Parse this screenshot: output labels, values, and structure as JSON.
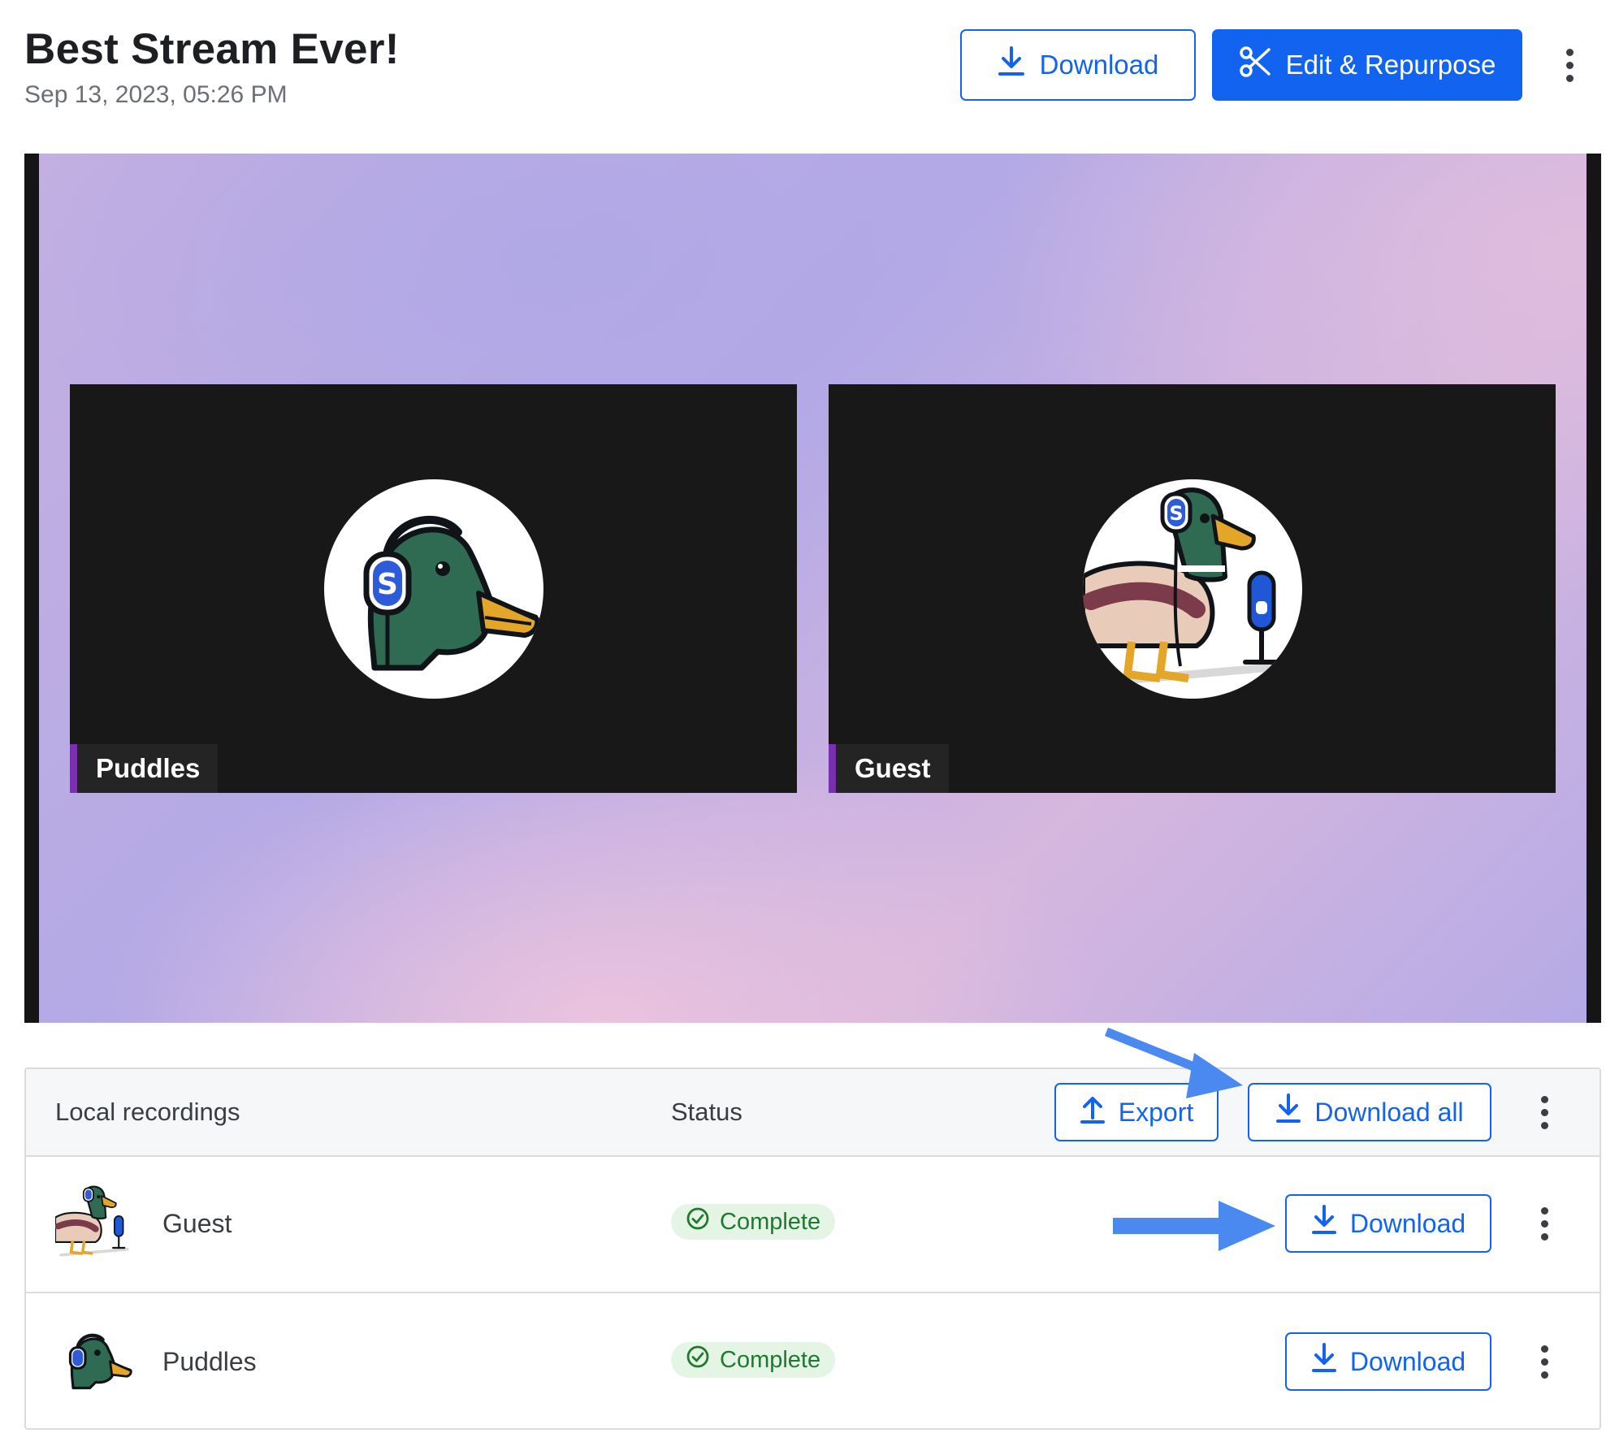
{
  "header": {
    "title": "Best Stream Ever!",
    "date": "Sep 13, 2023, 05:26 PM",
    "download_label": "Download",
    "edit_label": "Edit & Repurpose"
  },
  "video": {
    "tiles": [
      {
        "name": "Puddles"
      },
      {
        "name": "Guest"
      }
    ]
  },
  "recordings": {
    "col_local": "Local recordings",
    "col_status": "Status",
    "export_label": "Export",
    "download_all_label": "Download all",
    "rows": [
      {
        "name": "Guest",
        "status": "Complete",
        "download_label": "Download"
      },
      {
        "name": "Puddles",
        "status": "Complete",
        "download_label": "Download"
      }
    ]
  },
  "colors": {
    "accent": "#1264f0",
    "status_bg": "#e4f5e6",
    "status_text": "#1e7a2e",
    "annotation_arrow": "#4a8af0"
  },
  "icons": [
    "download-icon",
    "scissors-icon",
    "more-vertical-icon",
    "upload-icon",
    "check-circle-icon",
    "duck-headphones-avatar",
    "duck-microphone-avatar",
    "annotation-arrow"
  ]
}
